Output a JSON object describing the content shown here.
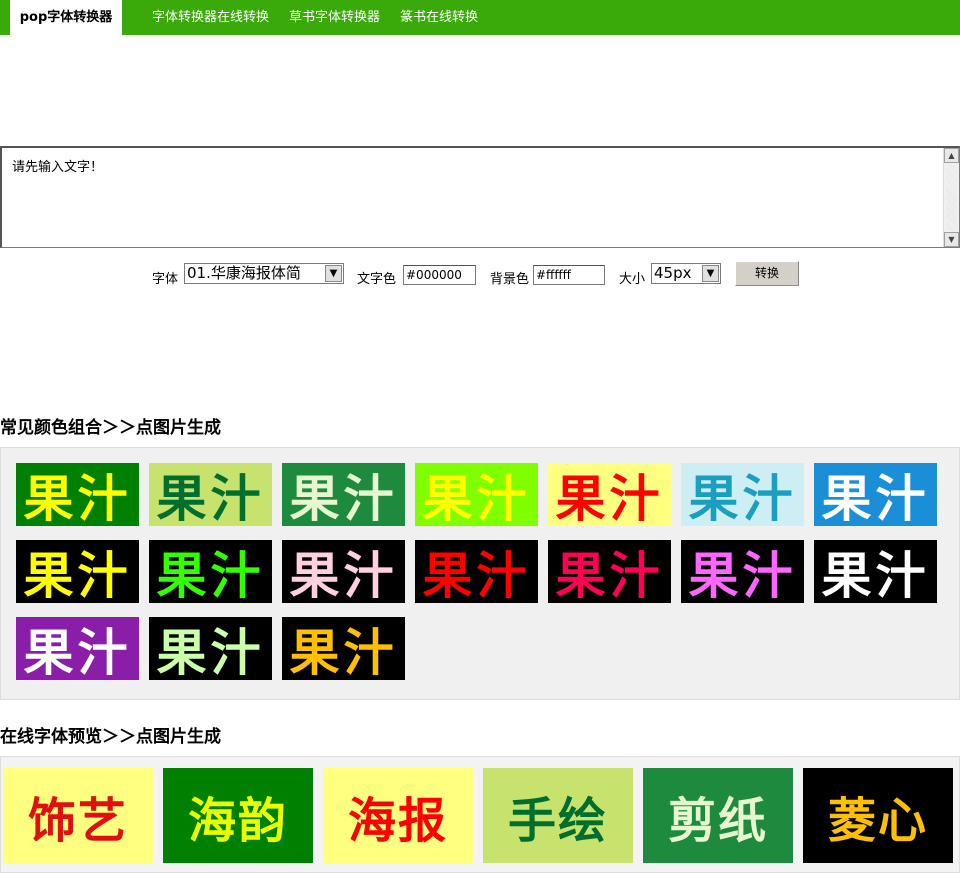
{
  "nav": {
    "active": "pop字体转换器",
    "links": [
      "字体转换器在线转换",
      "草书字体转换器",
      "篆书在线转换"
    ]
  },
  "editor": {
    "text": "请先输入文字！"
  },
  "controls": {
    "font_label": "字体",
    "font_value": "01.华康海报体简",
    "text_color_label": "文字色",
    "text_color_value": "#000000",
    "bg_color_label": "背景色",
    "bg_color_value": "#ffffff",
    "size_label": "大小",
    "size_value": "45px",
    "convert_label": "转换"
  },
  "color_section": {
    "title": "常见颜色组合＞＞点图片生成",
    "sample_text": "果汁",
    "swatches": [
      {
        "fg": "#ffff00",
        "bg": "#008000"
      },
      {
        "fg": "#006f2e",
        "bg": "#c8e36d"
      },
      {
        "fg": "#e6f6d0",
        "bg": "#1e8a3e"
      },
      {
        "fg": "#ffff00",
        "bg": "#80ff00"
      },
      {
        "fg": "#ff0000",
        "bg": "#ffff80"
      },
      {
        "fg": "#1a9fc0",
        "bg": "#cdeef5"
      },
      {
        "fg": "#ffffff",
        "bg": "#1a8fd8"
      },
      {
        "fg": "#ffff00",
        "bg": "#000000"
      },
      {
        "fg": "#33ff00",
        "bg": "#000000"
      },
      {
        "fg": "#ffd0e0",
        "bg": "#000000"
      },
      {
        "fg": "#ff0000",
        "bg": "#000000"
      },
      {
        "fg": "#ff0055",
        "bg": "#000000"
      },
      {
        "fg": "#ff66ff",
        "bg": "#000000"
      },
      {
        "fg": "#ffffff",
        "bg": "#000000"
      },
      {
        "fg": "#ffffff",
        "bg": "#8a1ea8"
      },
      {
        "fg": "#ccffaa",
        "bg": "#000000"
      },
      {
        "fg": "#ffc000",
        "bg": "#000000"
      }
    ]
  },
  "preview_section": {
    "title": "在线字体预览＞＞点图片生成",
    "items": [
      {
        "text": "饰艺",
        "fg": "#e01010",
        "bg": "#ffff80"
      },
      {
        "text": "海韵",
        "fg": "#e8ff00",
        "bg": "#008000"
      },
      {
        "text": "海报",
        "fg": "#ff0000",
        "bg": "#ffff80"
      },
      {
        "text": "手绘",
        "fg": "#006f2e",
        "bg": "#c8e36d"
      },
      {
        "text": "剪纸",
        "fg": "#e6f6d0",
        "bg": "#1e8a3e"
      },
      {
        "text": "菱心",
        "fg": "#ffc000",
        "bg": "#000000"
      }
    ]
  }
}
